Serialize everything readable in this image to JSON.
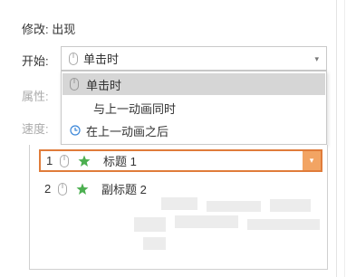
{
  "heading": "修改: 出现",
  "labels": {
    "start": "开始:",
    "property": "属性:",
    "speed": "速度:"
  },
  "combo": {
    "value": "单击时",
    "icon": "mouse-icon",
    "arrow": "▾"
  },
  "dropdown": {
    "options": [
      {
        "label": "单击时",
        "icon": "mouse-icon",
        "selected": true
      },
      {
        "label": "与上一动画同时",
        "icon": "",
        "selected": false
      },
      {
        "label": "在上一动画之后",
        "icon": "clock-icon",
        "selected": false
      }
    ]
  },
  "animation_list": [
    {
      "num": "1",
      "label": "标题 1",
      "icon": "star-icon",
      "selected": true
    },
    {
      "num": "2",
      "label": "副标题 2",
      "icon": "star-icon",
      "selected": false
    }
  ],
  "colors": {
    "accent": "#e07c3a",
    "star": "#4caf50",
    "clock": "#3a86d8"
  }
}
